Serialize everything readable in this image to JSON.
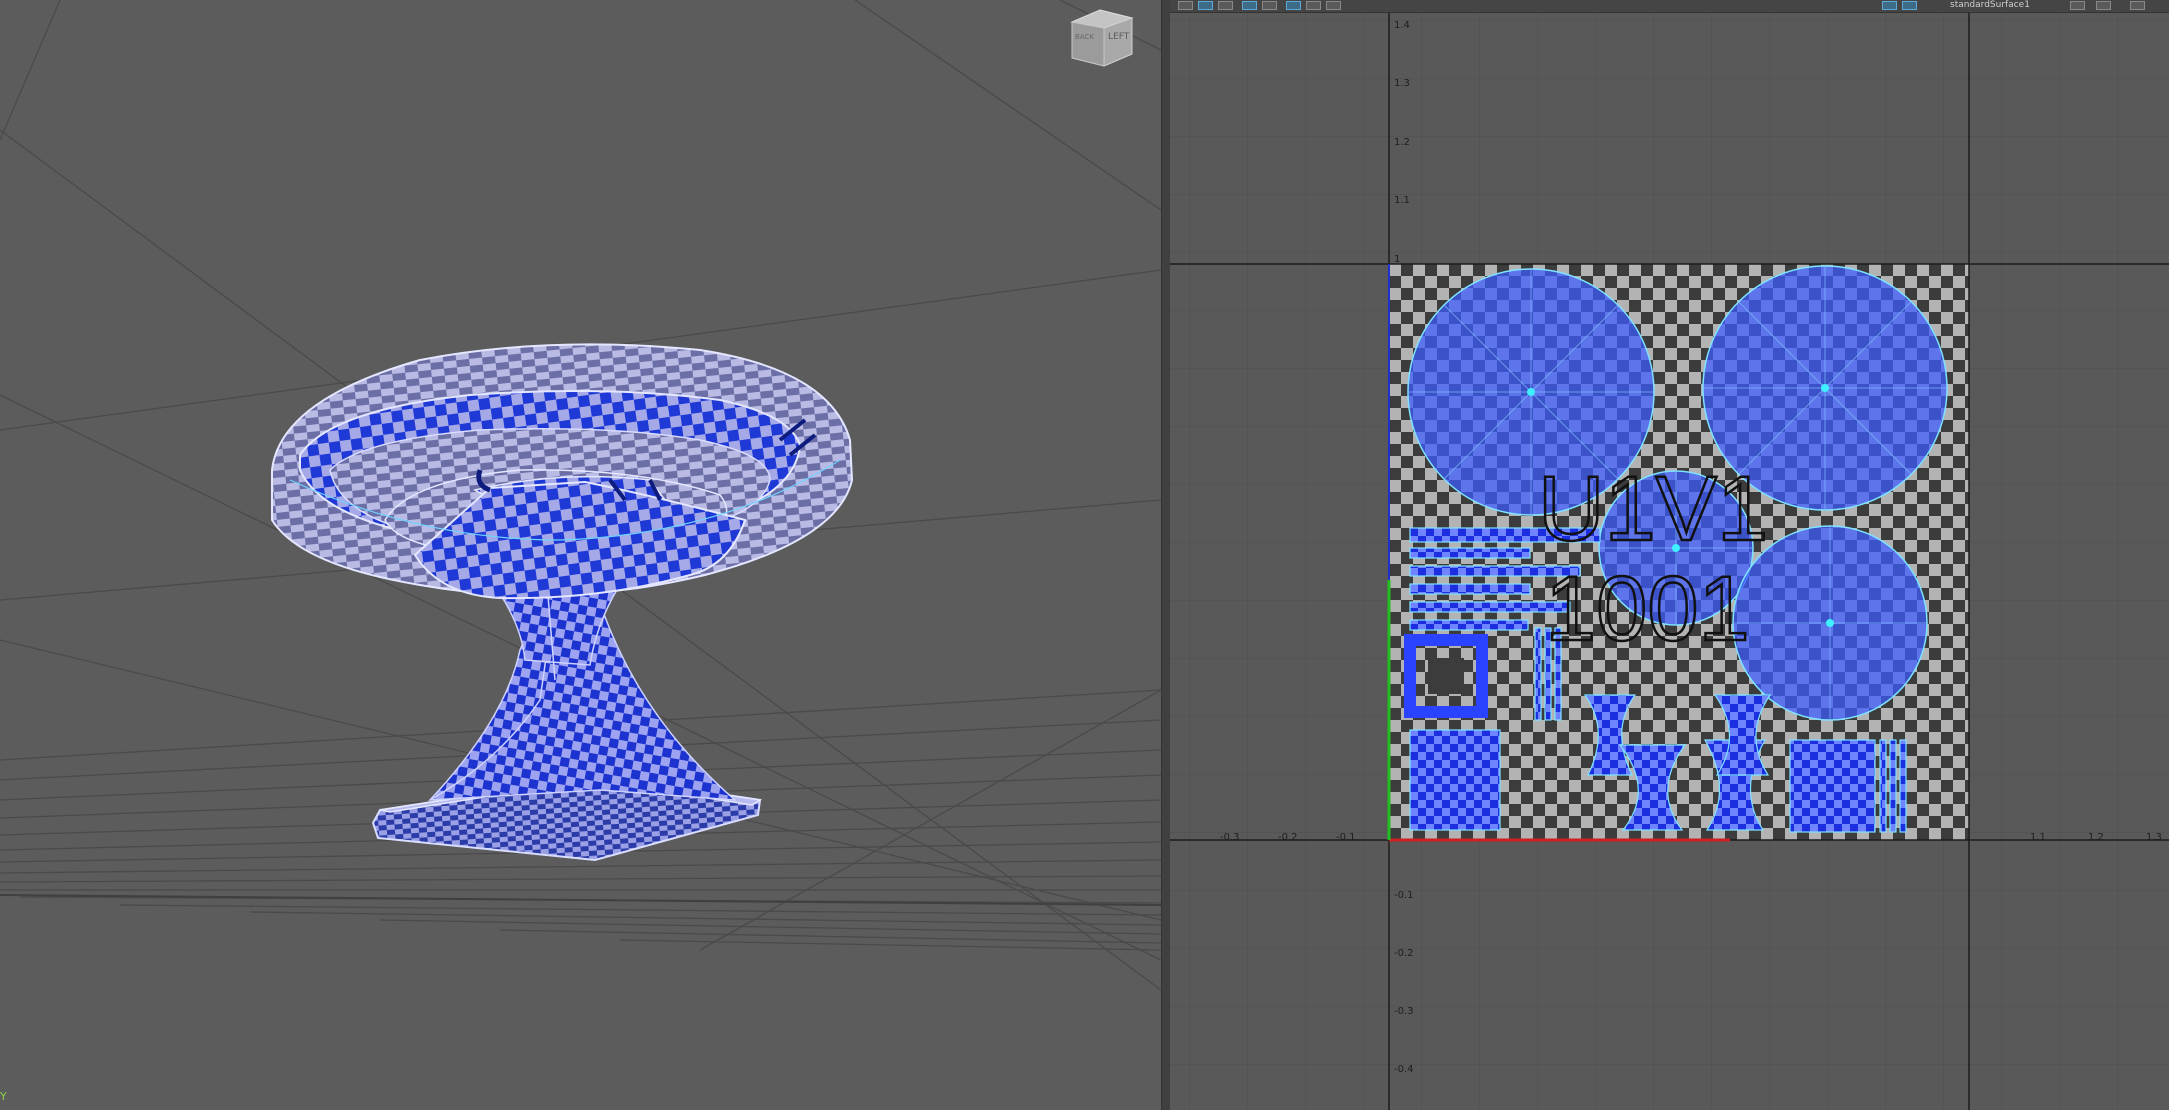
{
  "viewport3d": {
    "viewcube": {
      "right_face": "LEFT",
      "left_face": "BACK"
    },
    "axis_indicator": "Y"
  },
  "uv_editor": {
    "tile_text": {
      "line1": "U1V1",
      "line2": "1001"
    },
    "v_ticks": [
      "1.4",
      "1.3",
      "1.2",
      "1.1",
      "1",
      "-0.1",
      "-0.2",
      "-0.3",
      "-0.4"
    ],
    "u_ticks": [
      "-0.3",
      "-0.2",
      "-0.1",
      "1.1",
      "1.2",
      "1.3"
    ],
    "toolbar": {
      "texture_name": "standardSurface1"
    },
    "colors": {
      "uv_shell_fill": "#3b5bff",
      "uv_edge": "#7fe3ff",
      "grid_line": "#4e4e4e",
      "u_axis": "#d02020",
      "v_axis": "#20c020"
    }
  }
}
